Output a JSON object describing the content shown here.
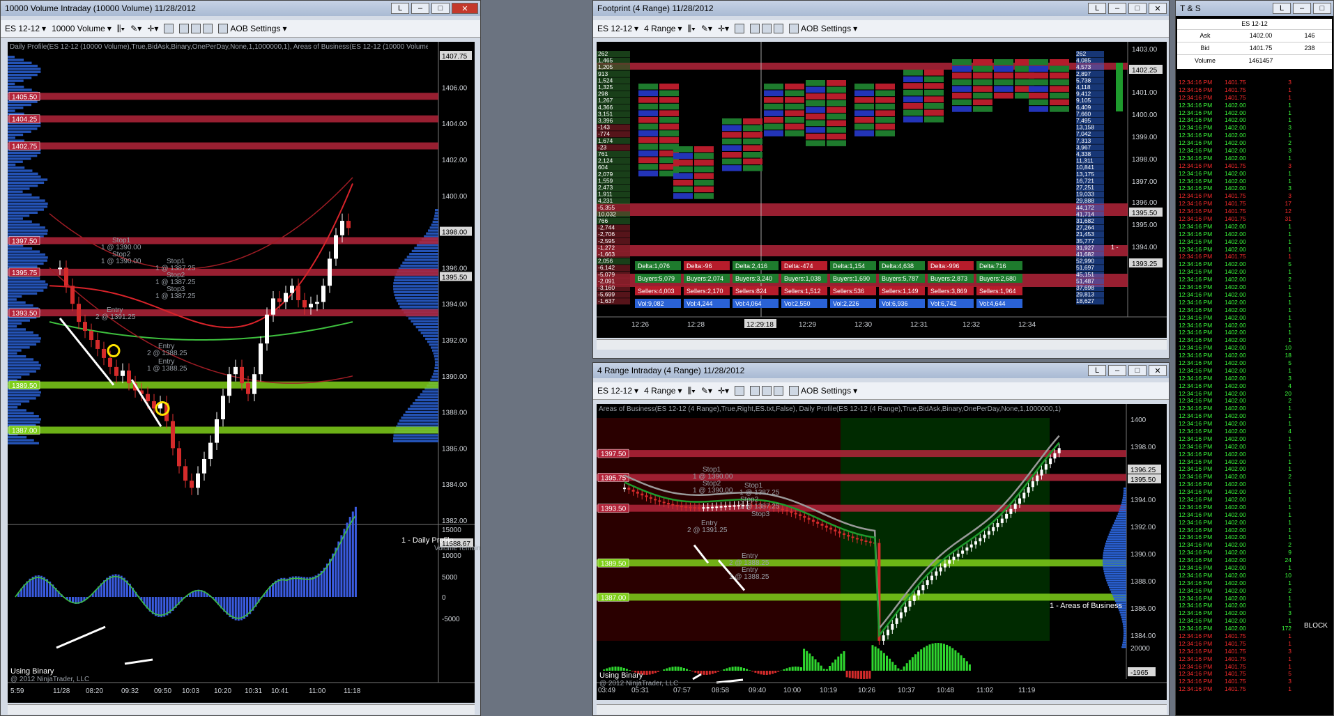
{
  "win1": {
    "title": "10000 Volume Intraday (10000 Volume)  11/28/2012",
    "instrument": "ES 12-12",
    "period": "10000 Volume",
    "aob": "AOB Settings",
    "header": "Daily Profile(ES 12-12 (10000 Volume),True,BidAsk,Binary,OnePerDay,None,1,1000000,1), Areas of Business(ES 12-12 (10000 Volume),True,Right,ES.t",
    "price_axis": [
      "1407.75",
      "1406.00",
      "1404.00",
      "1402.00",
      "1400.00",
      "1398.00",
      "1396.00",
      "1395.50",
      "1394.00",
      "1392.00",
      "1390.00",
      "1388.00",
      "1386.00",
      "1384.00",
      "1382.00"
    ],
    "levels": [
      "1405.50",
      "1404.25",
      "1402.75",
      "1397.50",
      "1395.75",
      "1393.50",
      "1389.50",
      "1387.00"
    ],
    "last_price": "1398.00",
    "labels": [
      "Stop1",
      "1 @ 1390.00",
      "Stop2",
      "1 @ 1390.00",
      "Stop1",
      "1 @ 1387.25",
      "Stop2",
      "1 @ 1387.25",
      "Stop3",
      "1 @ 1387.25",
      "Entry",
      "2 @ 1391.25",
      "Entry",
      "2 @ 1388.25",
      "Entry",
      "1 @ 1388.25"
    ],
    "indicator_name": "1 - Daily Profile",
    "volume_remaining": "Volume remaining = 9710",
    "osc_axis": [
      "15000",
      "11588.67",
      "10000",
      "5000",
      "0",
      "-5000"
    ],
    "osc_label": "Using Binary",
    "copyright": "@ 2012 NinjaTrader, LLC",
    "time_axis": [
      "5:59",
      "11/28",
      "08:20",
      "09:32",
      "09:50",
      "10:03",
      "10:20",
      "10:31",
      "10:41",
      "11:00",
      "11:18"
    ]
  },
  "win2": {
    "title": "Footprint (4 Range)  11/28/2012",
    "instrument": "ES 12-12",
    "period": "4 Range",
    "aob": "AOB Settings",
    "price_axis": [
      "1403.00",
      "1402.25",
      "1401.00",
      "1400.00",
      "1399.00",
      "1398.00",
      "1397.00",
      "1396.00",
      "1395.50",
      "1395.00",
      "1394.00",
      "1393.25"
    ],
    "time_axis": [
      "12:26",
      "12:28",
      "12:29:18",
      "12:29",
      "12:30",
      "12:31",
      "12:32",
      "12:34"
    ],
    "left_col": [
      "262",
      "1,465",
      "1,205",
      "913",
      "1,524",
      "1,325",
      "298",
      "1,267",
      "4,366",
      "3,151",
      "3,396",
      "-143",
      "-774",
      "1,674",
      "-23",
      "761",
      "2,124",
      "604",
      "2,079",
      "1,559",
      "2,473",
      "1,911",
      "4,231",
      "-5,355",
      "10,032",
      "766",
      "-2,744",
      "-2,706",
      "-2,595",
      "-1,272",
      "-1,663",
      "2,056",
      "-6,142",
      "-5,079",
      "-2,091",
      "-3,160",
      "-5,699",
      "-1,637"
    ],
    "right_col": [
      "262",
      "4,085",
      "4,573",
      "2,897",
      "5,738",
      "4,118",
      "9,412",
      "9,105",
      "6,409",
      "7,660",
      "7,495",
      "13,158",
      "7,042",
      "7,313",
      "3,967",
      "4,338",
      "11,311",
      "10,841",
      "13,175",
      "16,721",
      "27,251",
      "19,033",
      "29,888",
      "44,172",
      "41,714",
      "31,682",
      "27,264",
      "21,453",
      "35,777",
      "31,927",
      "41,682",
      "52,990",
      "51,697",
      "45,151",
      "51,487",
      "37,698",
      "29,813",
      "18,627"
    ],
    "stats": [
      [
        "Delta:1,076",
        "Buyers:5,079",
        "Sellers:4,003",
        "Vol:9,082"
      ],
      [
        "Delta:-96",
        "Buyers:2,074",
        "Sellers:2,170",
        "Vol:4,244"
      ],
      [
        "Delta:2,416",
        "Buyers:3,240",
        "Sellers:824",
        "Vol:4,064"
      ],
      [
        "Delta:-474",
        "Buyers:1,038",
        "Sellers:1,512",
        "Vol:2,550"
      ],
      [
        "Delta:1,154",
        "Buyers:1,690",
        "Sellers:536",
        "Vol:2,226"
      ],
      [
        "Delta:4,638",
        "Buyers:5,787",
        "Sellers:1,149",
        "Vol:6,936"
      ],
      [
        "Delta:-996",
        "Buyers:2,873",
        "Sellers:3,869",
        "Vol:6,742"
      ],
      [
        "Delta:716",
        "Buyers:2,680",
        "Sellers:1,964",
        "Vol:4,644"
      ]
    ],
    "one": "1 -"
  },
  "win3": {
    "title": "4 Range Intraday (4 Range)  11/28/2012",
    "instrument": "ES 12-12",
    "period": "4 Range",
    "aob": "AOB Settings",
    "header": "Areas of Business(ES 12-12 (4 Range),True,Right,ES.txt,False), Daily Profile(ES 12-12 (4 Range),True,BidAsk,Binary,OnePerDay,None,1,1000000,1)",
    "price_axis": [
      "1400",
      "1398.00",
      "1396.25",
      "1395.50",
      "1394.00",
      "1392.00",
      "1390.00",
      "1388.00",
      "1386.00",
      "1384.00"
    ],
    "levels": [
      "1397.50",
      "1395.75",
      "1393.50",
      "1389.50",
      "1387.00"
    ],
    "labels": [
      "Stop1",
      "1 @ 1390.00",
      "Stop2",
      "1 @ 1390.00",
      "Stop1",
      "1 @ 1387.25",
      "Stop2",
      "1 @ 1387.25",
      "Stop3",
      "Entry",
      "2 @ 1391.25",
      "Entry",
      "2 @ 1388.25",
      "Entry",
      "1 @ 1388.25"
    ],
    "indicator_name": "1 - Areas of Business",
    "osc_axis": [
      "20000",
      "-1965"
    ],
    "osc_label": "Using Binary",
    "copyright": "@ 2012 NinjaTrader, LLC",
    "time_axis": [
      "03:49",
      "05:31",
      "07:57",
      "08:58",
      "09:40",
      "10:00",
      "10:19",
      "10:26",
      "10:37",
      "10:48",
      "11:02",
      "11:19"
    ]
  },
  "ts": {
    "title": "T & S",
    "instrument": "ES 12-12",
    "ask_label": "Ask",
    "ask_price": "1402.00",
    "ask_size": "146",
    "bid_label": "Bid",
    "bid_price": "1401.75",
    "bid_size": "238",
    "vol_label": "Volume",
    "vol_value": "1461457",
    "block": "BLOCK",
    "rows": [
      [
        "12:34:16 PM",
        "1401.75",
        "3",
        "r"
      ],
      [
        "12:34:16 PM",
        "1401.75",
        "1",
        "r"
      ],
      [
        "12:34:16 PM",
        "1401.75",
        "1",
        "r"
      ],
      [
        "12:34:16 PM",
        "1402.00",
        "1",
        "g"
      ],
      [
        "12:34:16 PM",
        "1402.00",
        "1",
        "g"
      ],
      [
        "12:34:16 PM",
        "1402.00",
        "1",
        "g"
      ],
      [
        "12:34:16 PM",
        "1402.00",
        "3",
        "g"
      ],
      [
        "12:34:16 PM",
        "1402.00",
        "1",
        "g"
      ],
      [
        "12:34:16 PM",
        "1402.00",
        "2",
        "g"
      ],
      [
        "12:34:16 PM",
        "1402.00",
        "3",
        "g"
      ],
      [
        "12:34:16 PM",
        "1402.00",
        "1",
        "g"
      ],
      [
        "12:34:16 PM",
        "1401.75",
        "3",
        "r"
      ],
      [
        "12:34:16 PM",
        "1402.00",
        "1",
        "g"
      ],
      [
        "12:34:16 PM",
        "1402.00",
        "1",
        "g"
      ],
      [
        "12:34:16 PM",
        "1402.00",
        "3",
        "g"
      ],
      [
        "12:34:16 PM",
        "1401.75",
        "3",
        "r"
      ],
      [
        "12:34:16 PM",
        "1401.75",
        "17",
        "r"
      ],
      [
        "12:34:16 PM",
        "1401.75",
        "12",
        "r"
      ],
      [
        "12:34:16 PM",
        "1401.75",
        "31",
        "r"
      ],
      [
        "12:34:16 PM",
        "1402.00",
        "1",
        "g"
      ],
      [
        "12:34:16 PM",
        "1402.00",
        "1",
        "g"
      ],
      [
        "12:34:16 PM",
        "1402.00",
        "1",
        "g"
      ],
      [
        "12:34:16 PM",
        "1402.00",
        "1",
        "g"
      ],
      [
        "12:34:16 PM",
        "1401.75",
        "1",
        "r"
      ],
      [
        "12:34:16 PM",
        "1402.00",
        "5",
        "g"
      ],
      [
        "12:34:16 PM",
        "1402.00",
        "1",
        "g"
      ],
      [
        "12:34:16 PM",
        "1402.00",
        "2",
        "g"
      ],
      [
        "12:34:16 PM",
        "1402.00",
        "1",
        "g"
      ],
      [
        "12:34:16 PM",
        "1402.00",
        "1",
        "g"
      ],
      [
        "12:34:16 PM",
        "1402.00",
        "1",
        "g"
      ],
      [
        "12:34:16 PM",
        "1402.00",
        "1",
        "g"
      ],
      [
        "12:34:16 PM",
        "1402.00",
        "1",
        "g"
      ],
      [
        "12:34:16 PM",
        "1402.00",
        "1",
        "g"
      ],
      [
        "12:34:16 PM",
        "1402.00",
        "1",
        "g"
      ],
      [
        "12:34:16 PM",
        "1402.00",
        "1",
        "g"
      ],
      [
        "12:34:16 PM",
        "1402.00",
        "10",
        "g"
      ],
      [
        "12:34:16 PM",
        "1402.00",
        "18",
        "g"
      ],
      [
        "12:34:16 PM",
        "1402.00",
        "5",
        "g"
      ],
      [
        "12:34:16 PM",
        "1402.00",
        "1",
        "g"
      ],
      [
        "12:34:16 PM",
        "1402.00",
        "3",
        "g"
      ],
      [
        "12:34:16 PM",
        "1402.00",
        "4",
        "g"
      ],
      [
        "12:34:16 PM",
        "1402.00",
        "20",
        "g"
      ],
      [
        "12:34:16 PM",
        "1402.00",
        "2",
        "g"
      ],
      [
        "12:34:16 PM",
        "1402.00",
        "1",
        "g"
      ],
      [
        "12:34:16 PM",
        "1402.00",
        "1",
        "g"
      ],
      [
        "12:34:16 PM",
        "1402.00",
        "1",
        "g"
      ],
      [
        "12:34:16 PM",
        "1402.00",
        "4",
        "g"
      ],
      [
        "12:34:16 PM",
        "1402.00",
        "1",
        "g"
      ],
      [
        "12:34:16 PM",
        "1402.00",
        "1",
        "g"
      ],
      [
        "12:34:16 PM",
        "1402.00",
        "1",
        "g"
      ],
      [
        "12:34:16 PM",
        "1402.00",
        "1",
        "g"
      ],
      [
        "12:34:16 PM",
        "1402.00",
        "1",
        "g"
      ],
      [
        "12:34:16 PM",
        "1402.00",
        "2",
        "g"
      ],
      [
        "12:34:16 PM",
        "1402.00",
        "1",
        "g"
      ],
      [
        "12:34:16 PM",
        "1402.00",
        "1",
        "g"
      ],
      [
        "12:34:16 PM",
        "1402.00",
        "1",
        "g"
      ],
      [
        "12:34:16 PM",
        "1402.00",
        "1",
        "g"
      ],
      [
        "12:34:16 PM",
        "1402.00",
        "1",
        "g"
      ],
      [
        "12:34:16 PM",
        "1402.00",
        "1",
        "g"
      ],
      [
        "12:34:16 PM",
        "1402.00",
        "1",
        "g"
      ],
      [
        "12:34:16 PM",
        "1402.00",
        "1",
        "g"
      ],
      [
        "12:34:16 PM",
        "1402.00",
        "2",
        "g"
      ],
      [
        "12:34:16 PM",
        "1402.00",
        "9",
        "g"
      ],
      [
        "12:34:16 PM",
        "1402.00",
        "24",
        "g"
      ],
      [
        "12:34:16 PM",
        "1402.00",
        "1",
        "g"
      ],
      [
        "12:34:16 PM",
        "1402.00",
        "10",
        "g"
      ],
      [
        "12:34:16 PM",
        "1402.00",
        "1",
        "g"
      ],
      [
        "12:34:16 PM",
        "1402.00",
        "2",
        "g"
      ],
      [
        "12:34:16 PM",
        "1402.00",
        "1",
        "g"
      ],
      [
        "12:34:16 PM",
        "1402.00",
        "1",
        "g"
      ],
      [
        "12:34:16 PM",
        "1402.00",
        "3",
        "g"
      ],
      [
        "12:34:16 PM",
        "1402.00",
        "1",
        "g"
      ],
      [
        "12:34:16 PM",
        "1402.00",
        "172",
        "g"
      ],
      [
        "12:34:16 PM",
        "1401.75",
        "1",
        "r"
      ],
      [
        "12:34:16 PM",
        "1401.75",
        "1",
        "r"
      ],
      [
        "12:34:16 PM",
        "1401.75",
        "3",
        "r"
      ],
      [
        "12:34:16 PM",
        "1401.75",
        "1",
        "r"
      ],
      [
        "12:34:16 PM",
        "1401.75",
        "1",
        "r"
      ],
      [
        "12:34:16 PM",
        "1401.75",
        "5",
        "r"
      ],
      [
        "12:34:16 PM",
        "1401.75",
        "3",
        "r"
      ],
      [
        "12:34:16 PM",
        "1401.75",
        "1",
        "r"
      ]
    ]
  }
}
